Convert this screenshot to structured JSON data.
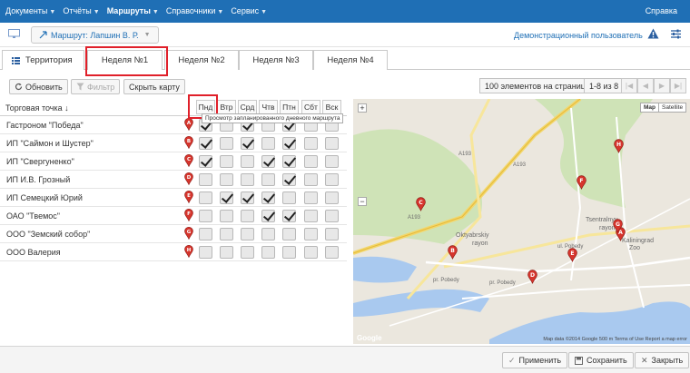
{
  "topbar": {
    "menu": [
      {
        "label": "Документы",
        "active": false
      },
      {
        "label": "Отчёты",
        "active": false
      },
      {
        "label": "Маршруты",
        "active": true
      },
      {
        "label": "Справочники",
        "active": false
      },
      {
        "label": "Сервис",
        "active": false
      }
    ],
    "help": "Справка"
  },
  "subbar": {
    "route_selector": "Маршрут: Лапшин В. Р.",
    "user": "Демонстрационный пользователь"
  },
  "tabs": [
    {
      "label": "Территория"
    },
    {
      "label": "Неделя №1"
    },
    {
      "label": "Неделя №2"
    },
    {
      "label": "Неделя №3"
    },
    {
      "label": "Неделя №4"
    }
  ],
  "toolbar": {
    "refresh": "Обновить",
    "filter": "Фильтр",
    "hide_map": "Скрыть карту",
    "page_size": "100 элементов на странице",
    "range": "1-8 из 8"
  },
  "grid": {
    "name_header": "Торговая точка",
    "sort_indicator": "↓",
    "days": [
      "Пнд",
      "Втр",
      "Срд",
      "Чтв",
      "Птн",
      "Сбт",
      "Вск"
    ],
    "tooltip": "Просмотр запланированного дневного маршрута",
    "rows": [
      {
        "name": "Гастроном \"Победа\"",
        "marker": "A",
        "days": [
          true,
          false,
          true,
          false,
          true,
          false,
          false
        ]
      },
      {
        "name": "ИП \"Саймон и Шустер\"",
        "marker": "B",
        "days": [
          true,
          false,
          true,
          false,
          true,
          false,
          false
        ]
      },
      {
        "name": "ИП \"Свергуненко\"",
        "marker": "C",
        "days": [
          true,
          false,
          false,
          true,
          true,
          false,
          false
        ]
      },
      {
        "name": "ИП И.В. Грозный",
        "marker": "D",
        "days": [
          false,
          false,
          false,
          false,
          true,
          false,
          false
        ]
      },
      {
        "name": "ИП Семецкий Юрий",
        "marker": "E",
        "days": [
          false,
          true,
          true,
          true,
          false,
          false,
          false
        ]
      },
      {
        "name": "ОАО \"Твемос\"",
        "marker": "F",
        "days": [
          false,
          false,
          false,
          true,
          true,
          false,
          false
        ]
      },
      {
        "name": "ООО \"Земский собор\"",
        "marker": "G",
        "days": [
          false,
          false,
          false,
          false,
          false,
          false,
          false
        ]
      },
      {
        "name": "ООО Валерия",
        "marker": "H",
        "days": [
          false,
          false,
          false,
          false,
          false,
          false,
          false
        ]
      }
    ]
  },
  "map": {
    "type_buttons": [
      "Map",
      "Satellite"
    ],
    "labels": [
      "Oktyabrskiy",
      "rayon",
      "Tsentralnyy",
      "rayon",
      "Kaliningrad",
      "Zoo",
      "A193",
      "A193",
      "A193",
      "ul. Pobedy",
      "pr. Pobedy",
      "pr. Pobedy"
    ],
    "attribution": "Map data ©2014 Google    500 m       Terms of Use    Report a map error",
    "google": "Google",
    "marker_color": "#d6352d"
  },
  "footer": {
    "apply": "Применить",
    "save": "Сохранить",
    "close": "Закрыть"
  },
  "colors": {
    "accent": "#1f6fb5",
    "highlight": "#e0202a"
  }
}
